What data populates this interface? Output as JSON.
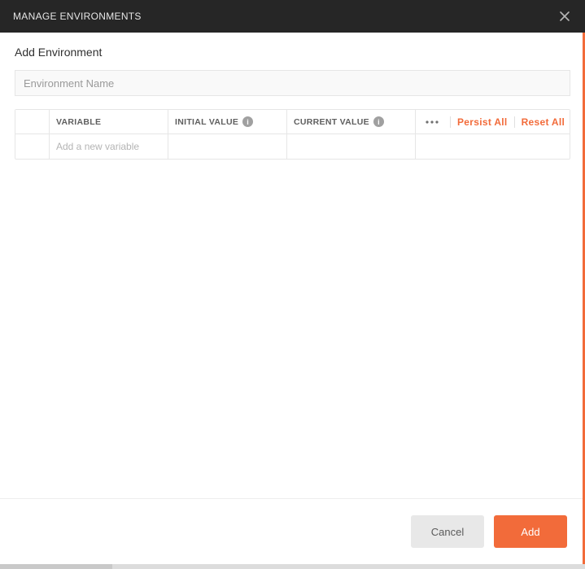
{
  "titlebar": {
    "title": "MANAGE ENVIRONMENTS"
  },
  "section": {
    "title": "Add Environment"
  },
  "env_name": {
    "placeholder": "Environment Name",
    "value": ""
  },
  "table": {
    "headers": {
      "variable": "VARIABLE",
      "initial_value": "INITIAL VALUE",
      "current_value": "CURRENT VALUE"
    },
    "actions": {
      "persist_all": "Persist All",
      "reset_all": "Reset All"
    },
    "new_row": {
      "placeholder": "Add a new variable"
    }
  },
  "footer": {
    "cancel": "Cancel",
    "add": "Add"
  }
}
